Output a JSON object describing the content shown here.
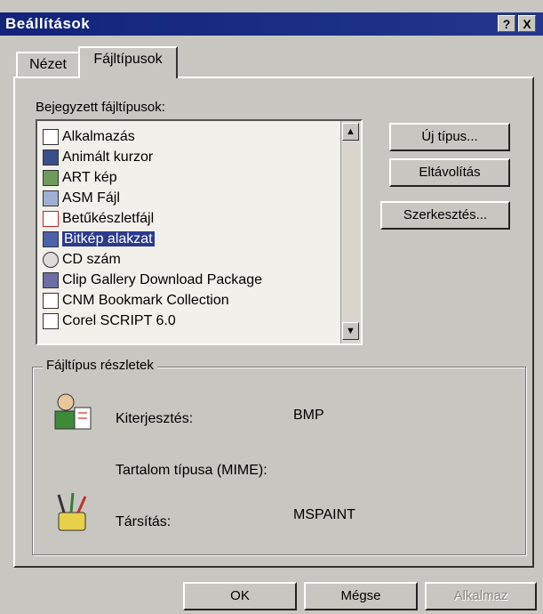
{
  "window": {
    "title": "Beállítások",
    "help_button": "?",
    "close_button": "X"
  },
  "tabs": [
    {
      "label": "Nézet",
      "active": false
    },
    {
      "label": "Fájltípusok",
      "active": true
    }
  ],
  "filetypes": {
    "label": "Bejegyzett fájltípusok:",
    "items": [
      {
        "label": "Alkalmazás",
        "icon": "application-icon"
      },
      {
        "label": "Animált kurzor",
        "icon": "animated-cursor-icon"
      },
      {
        "label": "ART kép",
        "icon": "art-image-icon"
      },
      {
        "label": "ASM Fájl",
        "icon": "asm-file-icon"
      },
      {
        "label": "Betűkészletfájl",
        "icon": "font-file-icon"
      },
      {
        "label": "Bitkép alakzat",
        "icon": "bitmap-icon",
        "selected": true
      },
      {
        "label": "CD szám",
        "icon": "cd-track-icon"
      },
      {
        "label": "Clip Gallery Download Package",
        "icon": "clip-gallery-icon"
      },
      {
        "label": "CNM Bookmark Collection",
        "icon": "bookmark-collection-icon"
      },
      {
        "label": "Corel SCRIPT 6.0",
        "icon": "corel-script-icon"
      }
    ]
  },
  "side_buttons": {
    "new_type": "Új típus...",
    "remove": "Eltávolítás",
    "edit": "Szerkesztés..."
  },
  "details": {
    "group_label": "Fájltípus részletek",
    "extension_label": "Kiterjesztés:",
    "extension_value": "BMP",
    "mime_label": "Tartalom típusa (MIME):",
    "mime_value": "",
    "association_label": "Társítás:",
    "association_value": "MSPAINT"
  },
  "footer": {
    "ok": "OK",
    "cancel": "Mégse",
    "apply": "Alkalmaz"
  },
  "colors": {
    "titlebar": "#1a2f86",
    "selection": "#2c3a8e",
    "face": "#c8c6c0"
  }
}
